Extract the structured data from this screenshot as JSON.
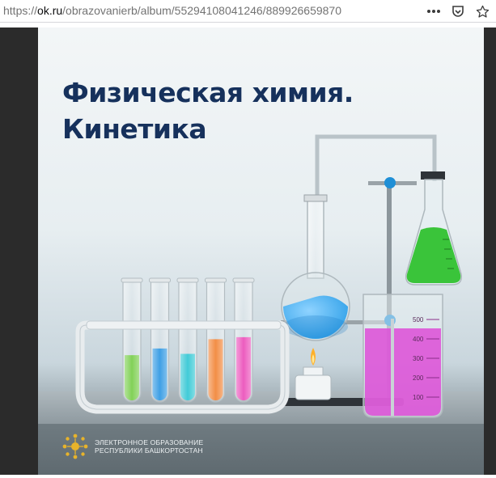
{
  "browser": {
    "url_prefix": "https://",
    "url_domain": "ok.ru",
    "url_path": "/obrazovanierb/album/55294108041246/889926659870",
    "actions": [
      "more-icon",
      "pocket-icon",
      "bookmark-star-icon"
    ]
  },
  "image": {
    "title_line1": "Физическая химия.",
    "title_line2": "Кинетика",
    "logo_line1": "ЭЛЕКТРОННОЕ ОБРАЗОВАНИЕ",
    "logo_line2": "РЕСПУБЛИКИ БАШКОРТОСТАН",
    "beaker_marks": [
      "500",
      "400",
      "300",
      "200",
      "100"
    ],
    "tube_colors": [
      "#6cc93a",
      "#1d8fe0",
      "#20c2d0",
      "#f07a26",
      "#e940b4"
    ],
    "flask_liquid_color": "#2fa0e8",
    "erlenmeyer_liquid_color": "#3ac43a",
    "beaker_liquid_color": "#dd55d8",
    "title_color": "#16315c"
  }
}
